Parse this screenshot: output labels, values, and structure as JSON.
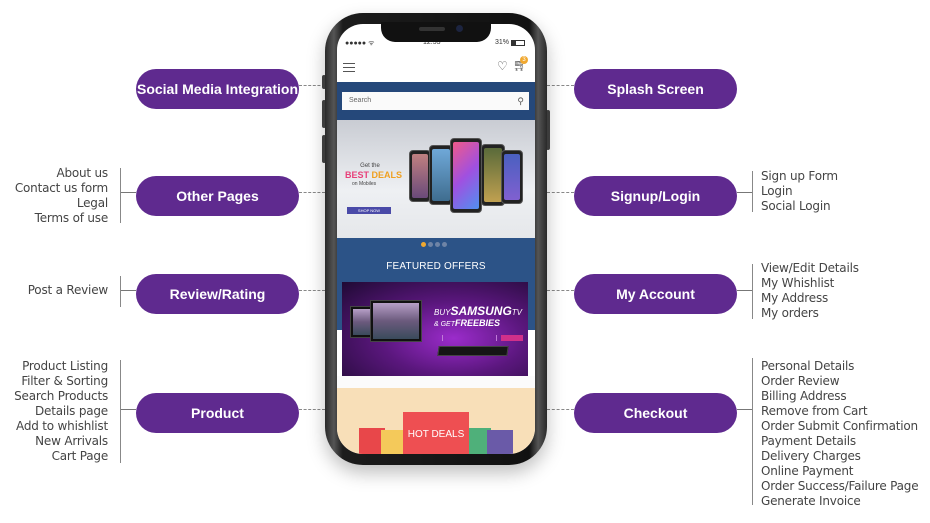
{
  "diagram": {
    "left_modules": [
      {
        "label": "Social Media Integration",
        "items": []
      },
      {
        "label": "Other Pages",
        "items": [
          "About us",
          "Contact us form",
          "Legal",
          "Terms of use"
        ]
      },
      {
        "label": "Review/Rating",
        "items": [
          "Post a Review"
        ]
      },
      {
        "label": "Product",
        "items": [
          "Product Listing",
          "Filter & Sorting",
          "Search Products",
          "Details page",
          "Add to whishlist",
          "New Arrivals",
          "Cart Page"
        ]
      }
    ],
    "right_modules": [
      {
        "label": "Splash Screen",
        "items": []
      },
      {
        "label": "Signup/Login",
        "items": [
          "Sign up Form",
          "Login",
          "Social Login"
        ]
      },
      {
        "label": "My Account",
        "items": [
          "View/Edit Details",
          "My Whishlist",
          "My Address",
          "My orders"
        ]
      },
      {
        "label": "Checkout",
        "items": [
          "Personal Details",
          "Order Review",
          "Billing Address",
          "Remove from Cart",
          "Order Submit Confirmation",
          "Payment Details",
          "Delivery Charges",
          "Online Payment",
          "Order Success/Failure Page",
          "Generate Invoice"
        ]
      }
    ],
    "colors": {
      "pill": "#5f2a8f",
      "banner_blue": "#2c5387",
      "accent_orange": "#f0a830"
    }
  },
  "phone": {
    "status": {
      "signal": "●●●●● ᯤ",
      "time": "12:53",
      "battery": "31%"
    },
    "appbar": {
      "menu_icon": "hamburger-icon",
      "wishlist_icon": "heart-icon",
      "cart_icon": "cart-icon",
      "cart_count": "3"
    },
    "search": {
      "placeholder": "Search",
      "icon": "search-icon"
    },
    "hero_banner": {
      "line1": "Get the",
      "best": "BEST",
      "deals": "DEALS",
      "line3": "on Mobiles",
      "cta": "SHOP NOW",
      "slide_count": 4,
      "active_slide": 1
    },
    "featured": {
      "title": "FEATURED OFFERS"
    },
    "promo": {
      "buy": "BUY",
      "brand": "SAMSUNG",
      "tv": "TV",
      "get": "& GET",
      "freebies": "FREEBIES"
    },
    "hot_deals": {
      "label": "HOT DEALS"
    }
  }
}
